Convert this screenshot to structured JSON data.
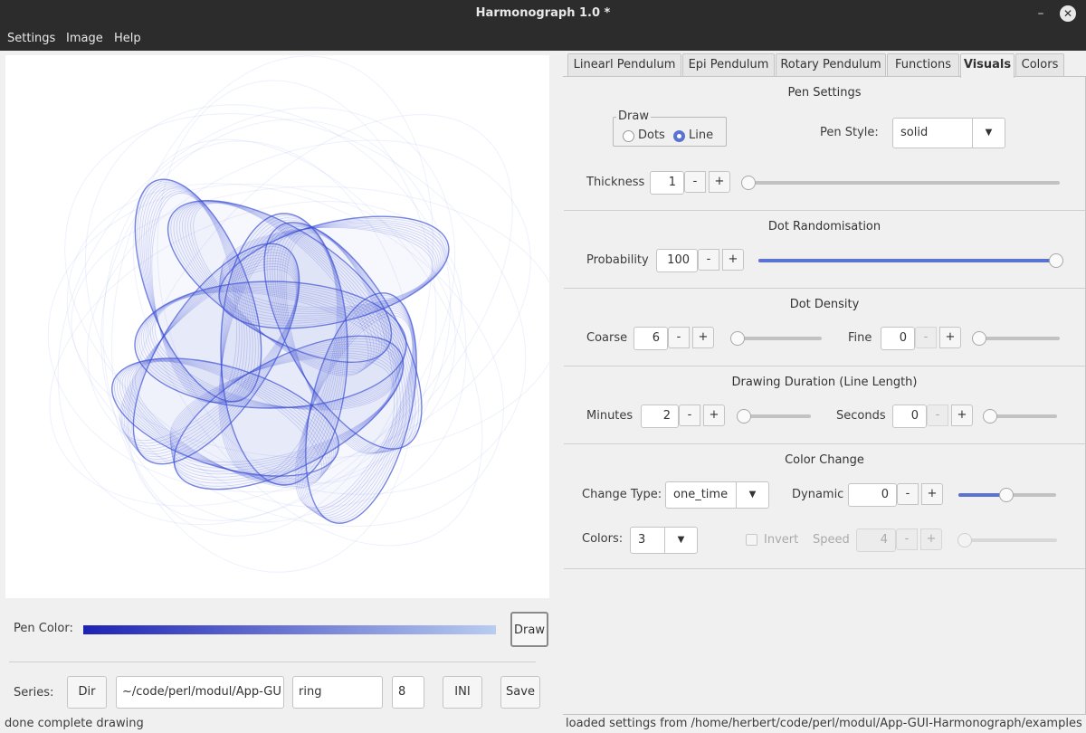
{
  "window": {
    "title": "Harmonograph 1.0 *",
    "minimize_glyph": "–",
    "close_glyph": "✕"
  },
  "menu": {
    "settings": "Settings",
    "image": "Image",
    "help": "Help"
  },
  "left": {
    "pen_color_label": "Pen Color:",
    "pen_gradient": [
      "#1e22b4",
      "#b9ccf0"
    ],
    "draw_button": "Draw",
    "series_label": "Series:",
    "dir_button": "Dir",
    "path_value": "~/code/perl/modul/App-GU",
    "name_value": "ring",
    "number_value": "8",
    "ini_button": "INI",
    "save_button": "Save"
  },
  "tabs": [
    "Linearl Pendulum",
    "Epi Pendulum",
    "Rotary Pendulum",
    "Functions",
    "Visuals",
    "Colors"
  ],
  "active_tab": "Visuals",
  "pen_settings": {
    "title": "Pen Settings",
    "draw_group": "Draw",
    "dots": "Dots",
    "line": "Line",
    "selected": "Line",
    "pen_style_label": "Pen Style:",
    "pen_style_value": "solid",
    "thickness_label": "Thickness",
    "thickness_value": "1",
    "thickness_level": 0.0
  },
  "dot_randomisation": {
    "title": "Dot Randomisation",
    "probability_label": "Probability",
    "probability_value": "100",
    "probability_level": 1.0
  },
  "dot_density": {
    "title": "Dot Density",
    "coarse_label": "Coarse",
    "coarse_value": "6",
    "coarse_level": 0.0,
    "fine_label": "Fine",
    "fine_value": "0",
    "fine_level": 0.0
  },
  "drawing_duration": {
    "title": "Drawing Duration (Line Length)",
    "minutes_label": "Minutes",
    "minutes_value": "2",
    "minutes_level": 0.0,
    "seconds_label": "Seconds",
    "seconds_value": "0",
    "seconds_level": 0.0
  },
  "color_change": {
    "title": "Color Change",
    "change_type_label": "Change Type:",
    "change_type_value": "one_time",
    "dynamic_label": "Dynamic",
    "dynamic_value": "0",
    "dynamic_level": 0.49,
    "colors_label": "Colors:",
    "colors_value": "3",
    "invert_label": "Invert",
    "speed_label": "Speed",
    "speed_value": "4",
    "speed_level": 0.0
  },
  "buttons": {
    "minus": "-",
    "plus": "+"
  },
  "status": {
    "left": "done complete drawing",
    "right": "loaded settings from /home/herbert/code/perl/modul/App-GUI-Harmonograph/examples/settir"
  },
  "colors": {
    "accent": "#5a72d1",
    "curve": "#3a4fd6",
    "titlebar": "#2c2c2c"
  }
}
